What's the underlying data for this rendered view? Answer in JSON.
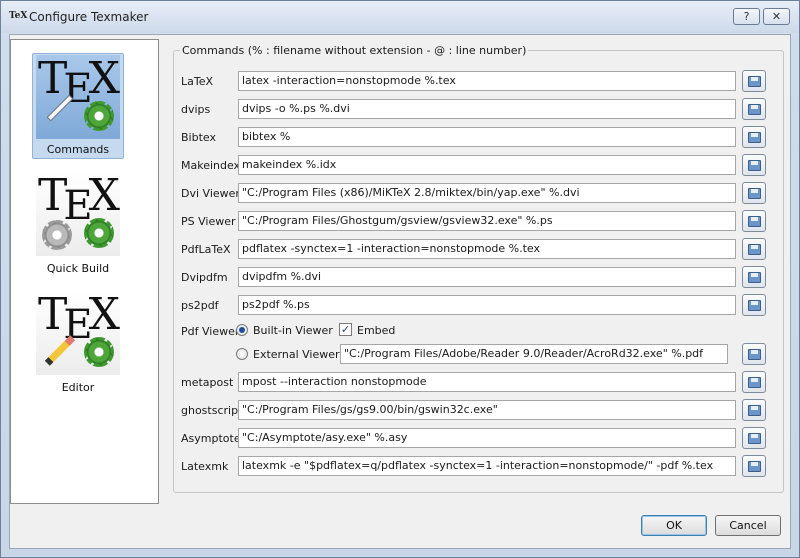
{
  "window": {
    "title": "Configure Texmaker",
    "icon_text": "TeX",
    "help_label": "?",
    "close_label": "✕"
  },
  "sidebar": {
    "items": [
      {
        "label": "Commands",
        "active": true
      },
      {
        "label": "Quick Build",
        "active": false
      },
      {
        "label": "Editor",
        "active": false
      }
    ],
    "logo_text": [
      "T",
      "E",
      "X"
    ]
  },
  "commands": {
    "group_title": "Commands (% : filename without extension - @ : line number)",
    "rows": [
      {
        "label": "LaTeX",
        "value": "latex -interaction=nonstopmode %.tex"
      },
      {
        "label": "dvips",
        "value": "dvips -o %.ps %.dvi"
      },
      {
        "label": "Bibtex",
        "value": "bibtex %"
      },
      {
        "label": "Makeindex",
        "value": "makeindex %.idx"
      },
      {
        "label": "Dvi Viewer",
        "value": "\"C:/Program Files (x86)/MiKTeX 2.8/miktex/bin/yap.exe\" %.dvi"
      },
      {
        "label": "PS Viewer",
        "value": "\"C:/Program Files/Ghostgum/gsview/gsview32.exe\" %.ps"
      },
      {
        "label": "PdfLaTeX",
        "value": "pdflatex -synctex=1 -interaction=nonstopmode %.tex"
      },
      {
        "label": "Dvipdfm",
        "value": "dvipdfm %.dvi"
      },
      {
        "label": "ps2pdf",
        "value": "ps2pdf %.ps"
      }
    ],
    "pdf_viewer": {
      "label": "Pdf Viewer",
      "builtin_label": "Built-in Viewer",
      "builtin_selected": true,
      "embed_label": "Embed",
      "embed_checked": true,
      "external_label": "External Viewer",
      "external_value": "\"C:/Program Files/Adobe/Reader 9.0/Reader/AcroRd32.exe\" %.pdf"
    },
    "rows2": [
      {
        "label": "metapost",
        "value": "mpost --interaction nonstopmode"
      },
      {
        "label": "ghostscript",
        "value": "\"C:/Program Files/gs/gs9.00/bin/gswin32c.exe\""
      },
      {
        "label": "Asymptote",
        "value": "\"C:/Asymptote/asy.exe\" %.asy"
      },
      {
        "label": "Latexmk",
        "value": "latexmk -e \"$pdflatex=q/pdflatex -synctex=1 -interaction=nonstopmode/\" -pdf %.tex"
      }
    ],
    "check_mark": "✓"
  },
  "buttons": {
    "ok_label": "OK",
    "cancel_label": "Cancel"
  }
}
